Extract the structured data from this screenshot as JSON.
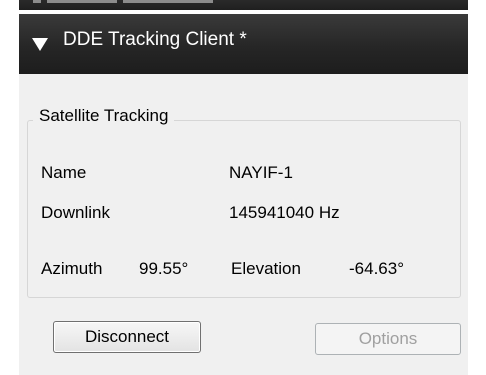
{
  "collapsed_section": {
    "title": ""
  },
  "client_section": {
    "title": "DDE Tracking Client *"
  },
  "satellite_tracking": {
    "group_title": "Satellite Tracking",
    "name_label": "Name",
    "name_value": "NAYIF-1",
    "downlink_label": "Downlink",
    "downlink_value": "145941040 Hz",
    "azimuth_label": "Azimuth",
    "azimuth_value": "99.55°",
    "elevation_label": "Elevation",
    "elevation_value": "-64.63°"
  },
  "buttons": {
    "disconnect_label": "Disconnect",
    "options_label": "Options"
  }
}
